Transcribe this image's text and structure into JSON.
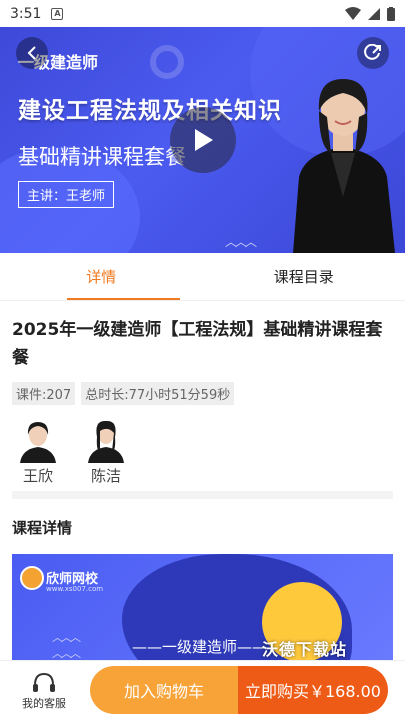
{
  "status_bar": {
    "time": "3:51",
    "notification_icon": "A"
  },
  "hero": {
    "subtitle": "一级建造师",
    "title": "建设工程法规及相关知识",
    "course_name": "基础精讲课程套餐",
    "teacher": "主讲：王老师",
    "icons": {
      "back": "back-icon",
      "share": "share-icon",
      "play": "play-icon"
    }
  },
  "tabs": [
    {
      "label": "详情",
      "active": true
    },
    {
      "label": "课程目录",
      "active": false
    }
  ],
  "course": {
    "title": "2025年一级建造师【工程法规】基础精讲课程套餐",
    "lessons": "课件:207",
    "duration": "总时长:77小时51分59秒"
  },
  "teachers": [
    {
      "name": "王欣"
    },
    {
      "name": "陈洁"
    }
  ],
  "details": {
    "section_title": "课程详情",
    "promo_logo": "欣师网校",
    "promo_logo_sub": "www.xs007.com",
    "promo_text": "——一级建造师——"
  },
  "watermark": "沃德下载站",
  "bottom_bar": {
    "service_label": "我的客服",
    "add_to_cart": "加入购物车",
    "buy_now": "立即购买￥168.00"
  },
  "colors": {
    "accent": "#f07a22",
    "cart": "#f7a338",
    "buy": "#ee5b16",
    "hero_bg": "#4352e0"
  }
}
